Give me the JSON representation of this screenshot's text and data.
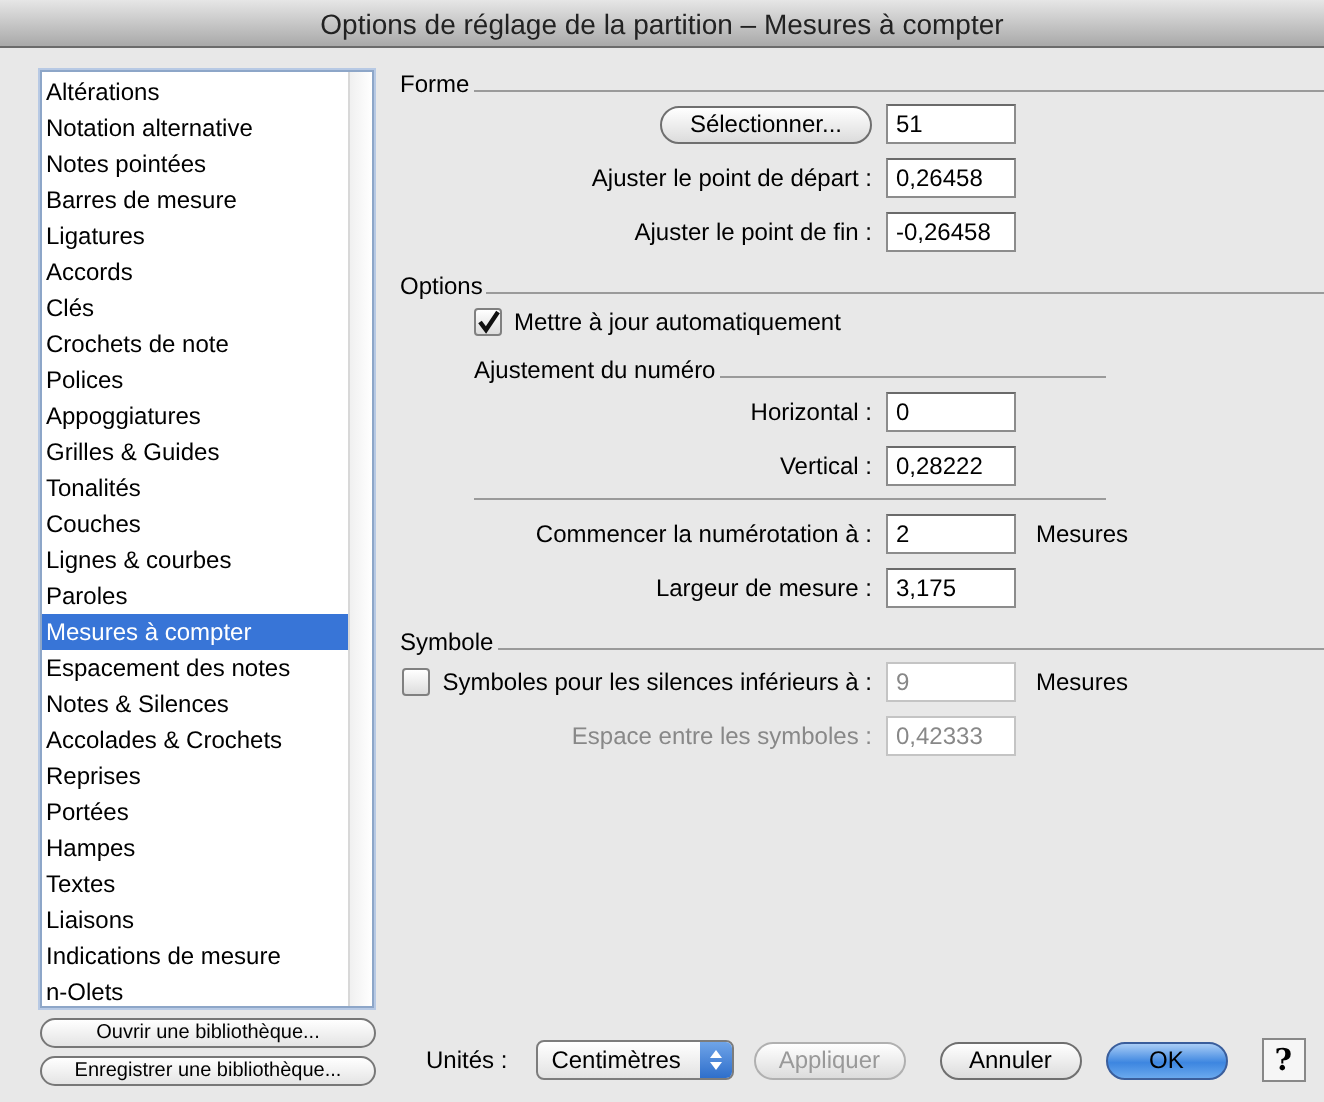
{
  "window": {
    "title": "Options de réglage de la partition – Mesures à compter"
  },
  "sidebar": {
    "items": [
      {
        "label": "Altérations",
        "selected": false
      },
      {
        "label": "Notation alternative",
        "selected": false
      },
      {
        "label": "Notes pointées",
        "selected": false
      },
      {
        "label": "Barres de mesure",
        "selected": false
      },
      {
        "label": "Ligatures",
        "selected": false
      },
      {
        "label": "Accords",
        "selected": false
      },
      {
        "label": "Clés",
        "selected": false
      },
      {
        "label": "Crochets de note",
        "selected": false
      },
      {
        "label": "Polices",
        "selected": false
      },
      {
        "label": "Appoggiatures",
        "selected": false
      },
      {
        "label": "Grilles & Guides",
        "selected": false
      },
      {
        "label": "Tonalités",
        "selected": false
      },
      {
        "label": "Couches",
        "selected": false
      },
      {
        "label": "Lignes & courbes",
        "selected": false
      },
      {
        "label": "Paroles",
        "selected": false
      },
      {
        "label": "Mesures à compter",
        "selected": true
      },
      {
        "label": "Espacement des notes",
        "selected": false
      },
      {
        "label": "Notes & Silences",
        "selected": false
      },
      {
        "label": "Accolades & Crochets",
        "selected": false
      },
      {
        "label": "Reprises",
        "selected": false
      },
      {
        "label": "Portées",
        "selected": false
      },
      {
        "label": "Hampes",
        "selected": false
      },
      {
        "label": "Textes",
        "selected": false
      },
      {
        "label": "Liaisons",
        "selected": false
      },
      {
        "label": "Indications de mesure",
        "selected": false
      },
      {
        "label": "n-Olets",
        "selected": false
      }
    ],
    "buttons": [
      "Ouvrir une bibliothèque...",
      "Enregistrer une bibliothèque..."
    ]
  },
  "sections": [
    {
      "title": "Forme",
      "rows": [
        {
          "kind": "button",
          "button": "Sélectionner...",
          "value": "51"
        },
        {
          "kind": "field",
          "label": "Ajuster le point de départ :",
          "value": "0,26458",
          "disabled": false
        },
        {
          "kind": "field",
          "label": "Ajuster le point de fin :",
          "value": "-0,26458",
          "disabled": false
        }
      ]
    },
    {
      "title": "Options",
      "rows": [
        {
          "kind": "check",
          "label": "Mettre à jour automatiquement",
          "checked": true
        },
        {
          "kind": "group",
          "title": "Ajustement du numéro",
          "rows": [
            {
              "kind": "field",
              "label": "Horizontal :",
              "value": "0",
              "disabled": false
            },
            {
              "kind": "field",
              "label": "Vertical :",
              "value": "0,28222",
              "disabled": false
            }
          ]
        },
        {
          "kind": "field",
          "label": "Commencer la numérotation à :",
          "value": "2",
          "unit": "Mesures",
          "disabled": false
        },
        {
          "kind": "field",
          "label": "Largeur de mesure :",
          "value": "3,175",
          "disabled": false
        }
      ]
    },
    {
      "title": "Symbole",
      "rows": [
        {
          "kind": "checkfield",
          "label": "Symboles pour les silences inférieurs à :",
          "checked": false,
          "value": "9",
          "unit": "Mesures",
          "disabled": true
        },
        {
          "kind": "field",
          "label": "Espace entre les symboles :",
          "value": "0,42333",
          "disabled": true
        }
      ]
    }
  ],
  "footer": {
    "units_label": "Unités :",
    "units": "Centimètres",
    "apply": {
      "label": "Appliquer",
      "disabled": true
    },
    "cancel": "Annuler",
    "ok": "OK",
    "help": "?"
  }
}
